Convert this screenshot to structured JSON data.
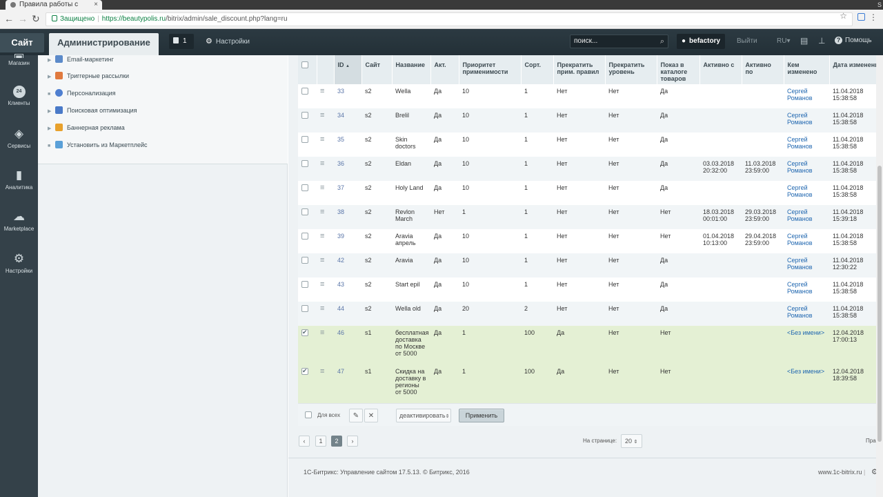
{
  "browser": {
    "tab_title": "Правила работы с",
    "secure_label": "Защищено",
    "url_host": "https://beautypolis.ru",
    "url_path": "/bitrix/admin/sale_discount.php?lang=ru"
  },
  "header": {
    "site_button": "Сайт",
    "admin_button": "Администрирование",
    "notifications_count": "1",
    "settings_label": "Настройки",
    "search_placeholder": "поиск...",
    "user_name": "befactory",
    "logout_label": "Выйти",
    "lang_label": "RU",
    "help_label": "Помощь"
  },
  "rail": [
    {
      "label": "Магазин",
      "icon": "shop-icon"
    },
    {
      "label": "Клиенты",
      "icon": "clients-icon",
      "badge": "24"
    },
    {
      "label": "Сервисы",
      "icon": "services-icon"
    },
    {
      "label": "Аналитика",
      "icon": "analytics-icon"
    },
    {
      "label": "Marketplace",
      "icon": "cloud-download-icon"
    },
    {
      "label": "Настройки",
      "icon": "gear-icon"
    }
  ],
  "menu": [
    {
      "label": "Email-маркетинг",
      "expandable": true
    },
    {
      "label": "Триггерные рассылки",
      "expandable": true
    },
    {
      "label": "Персонализация",
      "expandable": false
    },
    {
      "label": "Поисковая оптимизация",
      "expandable": true
    },
    {
      "label": "Баннерная реклама",
      "expandable": true
    },
    {
      "label": "Установить из Маркетплейс",
      "expandable": false
    }
  ],
  "table": {
    "columns": [
      "ID",
      "Сайт",
      "Название",
      "Акт.",
      "Приоритет применимости",
      "Сорт.",
      "Прекратить прим. правил",
      "Прекратить уровень",
      "Показ в каталоге товаров",
      "Активно с",
      "Активно по",
      "Кем изменено",
      "Дата изменения"
    ],
    "rows": [
      {
        "id": "33",
        "site": "s2",
        "name": "Wella",
        "active": "Да",
        "priority": "10",
        "sort": "1",
        "stop_rules": "Нет",
        "stop_level": "Нет",
        "show_catalog": "Да",
        "from": "",
        "to": "",
        "modified_by": "Сергей Романов",
        "modified_at": "11.04.2018 15:38:58",
        "checked": false
      },
      {
        "id": "34",
        "site": "s2",
        "name": "Brelil",
        "active": "Да",
        "priority": "10",
        "sort": "1",
        "stop_rules": "Нет",
        "stop_level": "Нет",
        "show_catalog": "Да",
        "from": "",
        "to": "",
        "modified_by": "Сергей Романов",
        "modified_at": "11.04.2018 15:38:58",
        "checked": false
      },
      {
        "id": "35",
        "site": "s2",
        "name": "Skin doctors",
        "active": "Да",
        "priority": "10",
        "sort": "1",
        "stop_rules": "Нет",
        "stop_level": "Нет",
        "show_catalog": "Да",
        "from": "",
        "to": "",
        "modified_by": "Сергей Романов",
        "modified_at": "11.04.2018 15:38:58",
        "checked": false
      },
      {
        "id": "36",
        "site": "s2",
        "name": "Eldan",
        "active": "Да",
        "priority": "10",
        "sort": "1",
        "stop_rules": "Нет",
        "stop_level": "Нет",
        "show_catalog": "Да",
        "from": "03.03.2018 20:32:00",
        "to": "11.03.2018 23:59:00",
        "modified_by": "Сергей Романов",
        "modified_at": "11.04.2018 15:38:58",
        "checked": false
      },
      {
        "id": "37",
        "site": "s2",
        "name": "Holy Land",
        "active": "Да",
        "priority": "10",
        "sort": "1",
        "stop_rules": "Нет",
        "stop_level": "Нет",
        "show_catalog": "Да",
        "from": "",
        "to": "",
        "modified_by": "Сергей Романов",
        "modified_at": "11.04.2018 15:38:58",
        "checked": false
      },
      {
        "id": "38",
        "site": "s2",
        "name": "Revlon March",
        "active": "Нет",
        "priority": "1",
        "sort": "1",
        "stop_rules": "Нет",
        "stop_level": "Нет",
        "show_catalog": "Нет",
        "from": "18.03.2018 00:01:00",
        "to": "29.03.2018 23:59:00",
        "modified_by": "Сергей Романов",
        "modified_at": "11.04.2018 15:39:18",
        "checked": false
      },
      {
        "id": "39",
        "site": "s2",
        "name": "Aravia апрель",
        "active": "Да",
        "priority": "10",
        "sort": "1",
        "stop_rules": "Нет",
        "stop_level": "Нет",
        "show_catalog": "Нет",
        "from": "01.04.2018 10:13:00",
        "to": "29.04.2018 23:59:00",
        "modified_by": "Сергей Романов",
        "modified_at": "11.04.2018 15:38:58",
        "checked": false
      },
      {
        "id": "42",
        "site": "s2",
        "name": "Aravia",
        "active": "Да",
        "priority": "10",
        "sort": "1",
        "stop_rules": "Нет",
        "stop_level": "Нет",
        "show_catalog": "Да",
        "from": "",
        "to": "",
        "modified_by": "Сергей Романов",
        "modified_at": "11.04.2018 12:30:22",
        "checked": false
      },
      {
        "id": "43",
        "site": "s2",
        "name": "Start epil",
        "active": "Да",
        "priority": "10",
        "sort": "1",
        "stop_rules": "Нет",
        "stop_level": "Нет",
        "show_catalog": "Да",
        "from": "",
        "to": "",
        "modified_by": "Сергей Романов",
        "modified_at": "11.04.2018 15:38:58",
        "checked": false
      },
      {
        "id": "44",
        "site": "s2",
        "name": "Wella old",
        "active": "Да",
        "priority": "20",
        "sort": "2",
        "stop_rules": "Нет",
        "stop_level": "Нет",
        "show_catalog": "Да",
        "from": "",
        "to": "",
        "modified_by": "Сергей Романов",
        "modified_at": "11.04.2018 15:38:58",
        "checked": false
      },
      {
        "id": "46",
        "site": "s1",
        "name": "бесплатная доставка по Москве от 5000",
        "active": "Да",
        "priority": "1",
        "sort": "100",
        "stop_rules": "Да",
        "stop_level": "Нет",
        "show_catalog": "Нет",
        "from": "",
        "to": "",
        "modified_by": "<Без имени>",
        "modified_at": "12.04.2018 17:00:13",
        "checked": true
      },
      {
        "id": "47",
        "site": "s1",
        "name": "Скидка на доставку в регионы от 5000",
        "active": "Да",
        "priority": "1",
        "sort": "100",
        "stop_rules": "Да",
        "stop_level": "Нет",
        "show_catalog": "Нет",
        "from": "",
        "to": "",
        "modified_by": "<Без имени>",
        "modified_at": "12.04.2018 18:39:58",
        "checked": true
      }
    ]
  },
  "actions": {
    "for_all": "Для всех",
    "action_select": "деактивировать",
    "apply": "Применить"
  },
  "pagination": {
    "prev": "‹",
    "pages": [
      "1",
      "2"
    ],
    "current": "2",
    "next": "›",
    "per_page_label": "На странице:",
    "per_page": "20",
    "right_label": "Пра"
  },
  "footer": {
    "copyright": "1С-Битрикс: Управление сайтом 17.5.13. © Битрикс, 2016",
    "site_link": "www.1c-bitrix.ru"
  }
}
